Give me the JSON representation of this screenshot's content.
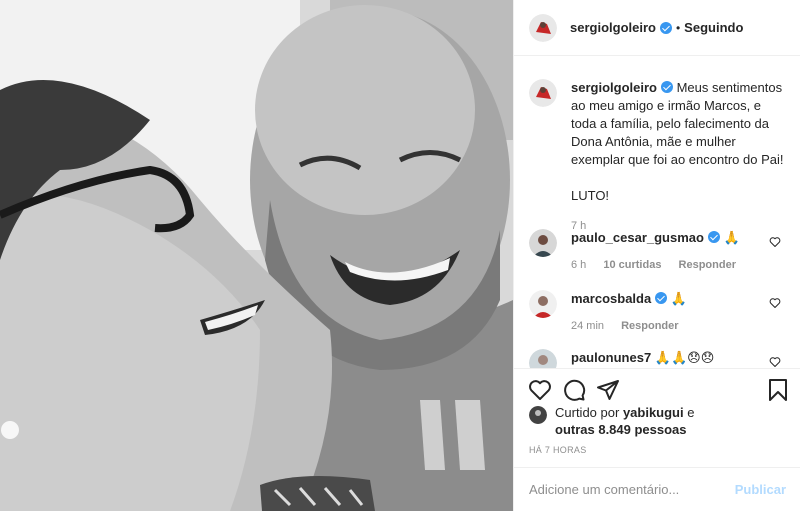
{
  "header": {
    "username": "sergiolgoleiro",
    "separator": "•",
    "follow_label": "Seguindo"
  },
  "caption": {
    "username": "sergiolgoleiro",
    "text": "Meus sentimentos ao meu amigo e irmão Marcos, e toda a família, pelo falecimento da Dona Antônia, mãe e mulher exemplar que foi ao encontro do Pai!",
    "extra": "LUTO!",
    "time": "7 h"
  },
  "comments": [
    {
      "username": "paulo_cesar_gusmao",
      "text": "🙏",
      "time": "6 h",
      "likes": "10 curtidas",
      "reply": "Responder"
    },
    {
      "username": "marcosbalda",
      "text": "🙏",
      "time": "24 min",
      "reply": "Responder"
    },
    {
      "username": "paulonunes7",
      "text": "🙏🙏😞😞"
    }
  ],
  "likes": {
    "prefix": "Curtido por",
    "user": "yabikugui",
    "conj": "e",
    "others": "outras 8.849 pessoas"
  },
  "timestamp": "HÁ 7 HORAS",
  "add_comment": {
    "placeholder": "Adicione um comentário...",
    "publish_label": "Publicar"
  },
  "icons": {
    "like": "heart-icon",
    "comment": "comment-icon",
    "share": "share-icon",
    "save": "bookmark-icon"
  },
  "colors": {
    "verified": "#3897f0",
    "text": "#262626",
    "muted": "#8e8e8e",
    "publish_disabled": "#b3dbff"
  }
}
